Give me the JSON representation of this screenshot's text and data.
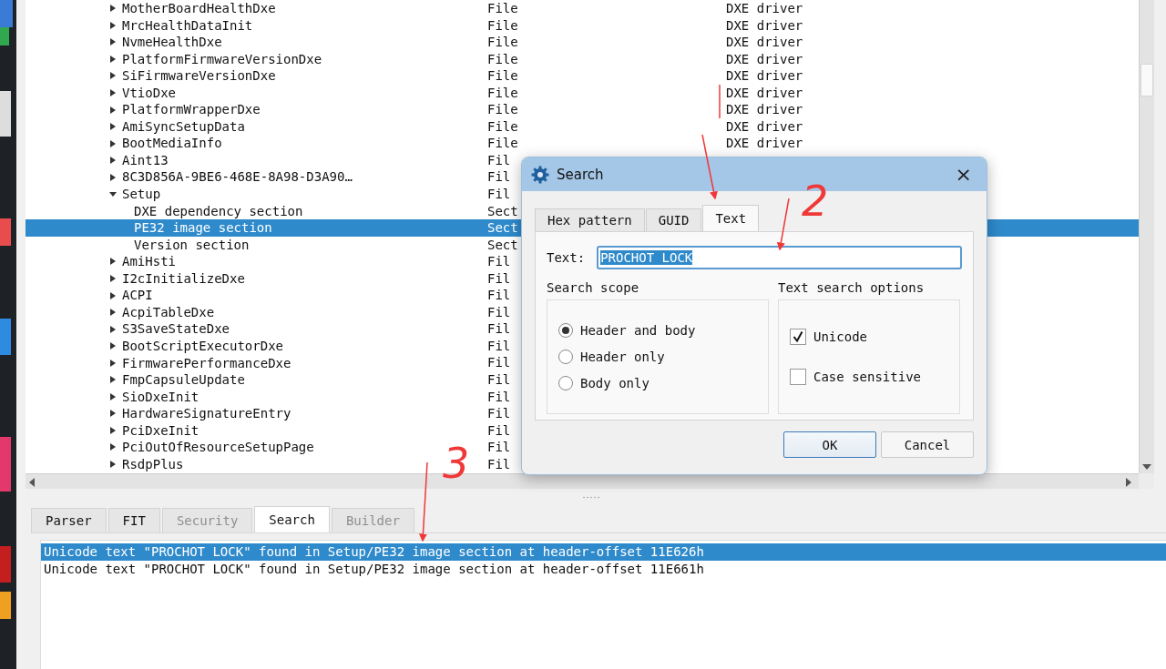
{
  "tree": {
    "rows": [
      {
        "name": "MotherBoardHealthDxe",
        "type": "File",
        "subtype": "DXE driver",
        "expanded": false,
        "selected": false
      },
      {
        "name": "MrcHealthDataInit",
        "type": "File",
        "subtype": "DXE driver",
        "expanded": false,
        "selected": false
      },
      {
        "name": "NvmeHealthDxe",
        "type": "File",
        "subtype": "DXE driver",
        "expanded": false,
        "selected": false
      },
      {
        "name": "PlatformFirmwareVersionDxe",
        "type": "File",
        "subtype": "DXE driver",
        "expanded": false,
        "selected": false
      },
      {
        "name": "SiFirmwareVersionDxe",
        "type": "File",
        "subtype": "DXE driver",
        "expanded": false,
        "selected": false
      },
      {
        "name": "VtioDxe",
        "type": "File",
        "subtype": "DXE driver",
        "expanded": false,
        "selected": false
      },
      {
        "name": "PlatformWrapperDxe",
        "type": "File",
        "subtype": "DXE driver",
        "expanded": false,
        "selected": false
      },
      {
        "name": "AmiSyncSetupData",
        "type": "File",
        "subtype": "DXE driver",
        "expanded": false,
        "selected": false
      },
      {
        "name": "BootMediaInfo",
        "type": "File",
        "subtype": "DXE driver",
        "expanded": false,
        "selected": false
      },
      {
        "name": "Aint13",
        "type": "Fil",
        "expanded": false,
        "selected": false
      },
      {
        "name": "8C3D856A-9BE6-468E-8A98-D3A90…",
        "type": "Fil",
        "expanded": false,
        "selected": false
      },
      {
        "name": "Setup",
        "type": "Fil",
        "expanded": true,
        "selected": false,
        "children": [
          {
            "name": "DXE dependency section",
            "type": "Sect",
            "selected": false
          },
          {
            "name": "PE32 image section",
            "type": "Sect",
            "selected": true
          },
          {
            "name": "Version section",
            "type": "Sect",
            "selected": false
          }
        ]
      },
      {
        "name": "AmiHsti",
        "type": "Fil",
        "expanded": false,
        "selected": false
      },
      {
        "name": "I2cInitializeDxe",
        "type": "Fil",
        "expanded": false,
        "selected": false
      },
      {
        "name": "ACPI",
        "type": "Fil",
        "expanded": false,
        "selected": false
      },
      {
        "name": "AcpiTableDxe",
        "type": "Fil",
        "expanded": false,
        "selected": false
      },
      {
        "name": "S3SaveStateDxe",
        "type": "Fil",
        "expanded": false,
        "selected": false
      },
      {
        "name": "BootScriptExecutorDxe",
        "type": "Fil",
        "expanded": false,
        "selected": false
      },
      {
        "name": "FirmwarePerformanceDxe",
        "type": "Fil",
        "expanded": false,
        "selected": false
      },
      {
        "name": "FmpCapsuleUpdate",
        "type": "Fil",
        "expanded": false,
        "selected": false
      },
      {
        "name": "SioDxeInit",
        "type": "Fil",
        "expanded": false,
        "selected": false
      },
      {
        "name": "HardwareSignatureEntry",
        "type": "Fil",
        "expanded": false,
        "selected": false
      },
      {
        "name": "PciDxeInit",
        "type": "Fil",
        "expanded": false,
        "selected": false
      },
      {
        "name": "PciOutOfResourceSetupPage",
        "type": "Fil",
        "expanded": false,
        "selected": false
      },
      {
        "name": "RsdpPlus",
        "type": "Fil",
        "expanded": false,
        "selected": false
      }
    ]
  },
  "bottom_tabs": [
    {
      "label": "Parser",
      "selected": false,
      "disabled": false
    },
    {
      "label": "FIT",
      "selected": false,
      "disabled": false
    },
    {
      "label": "Security",
      "selected": false,
      "disabled": true
    },
    {
      "label": "Search",
      "selected": true,
      "disabled": false
    },
    {
      "label": "Builder",
      "selected": false,
      "disabled": true
    }
  ],
  "results": [
    {
      "text": "Unicode text \"PROCHOT LOCK\" found in Setup/PE32 image section at header-offset 11E626h",
      "selected": true
    },
    {
      "text": "Unicode text \"PROCHOT LOCK\" found in Setup/PE32 image section at header-offset 11E661h",
      "selected": false
    }
  ],
  "dialog": {
    "title": "Search",
    "close": "×",
    "tabs": [
      {
        "label": "Hex pattern",
        "selected": false
      },
      {
        "label": "GUID",
        "selected": false
      },
      {
        "label": "Text",
        "selected": true
      }
    ],
    "text_label": "Text:",
    "text_value": "PROCHOT LOCK",
    "scope": {
      "title": "Search scope",
      "options": [
        {
          "label": "Header and body",
          "selected": true
        },
        {
          "label": "Header only",
          "selected": false
        },
        {
          "label": "Body only",
          "selected": false
        }
      ]
    },
    "options": {
      "title": "Text search options",
      "items": [
        {
          "label": "Unicode",
          "checked": true
        },
        {
          "label": "Case sensitive",
          "checked": false
        }
      ]
    },
    "buttons": [
      {
        "label": "OK",
        "default": true
      },
      {
        "label": "Cancel",
        "default": false
      }
    ]
  },
  "annotations": [
    {
      "label": "2"
    },
    {
      "label": "3"
    }
  ]
}
